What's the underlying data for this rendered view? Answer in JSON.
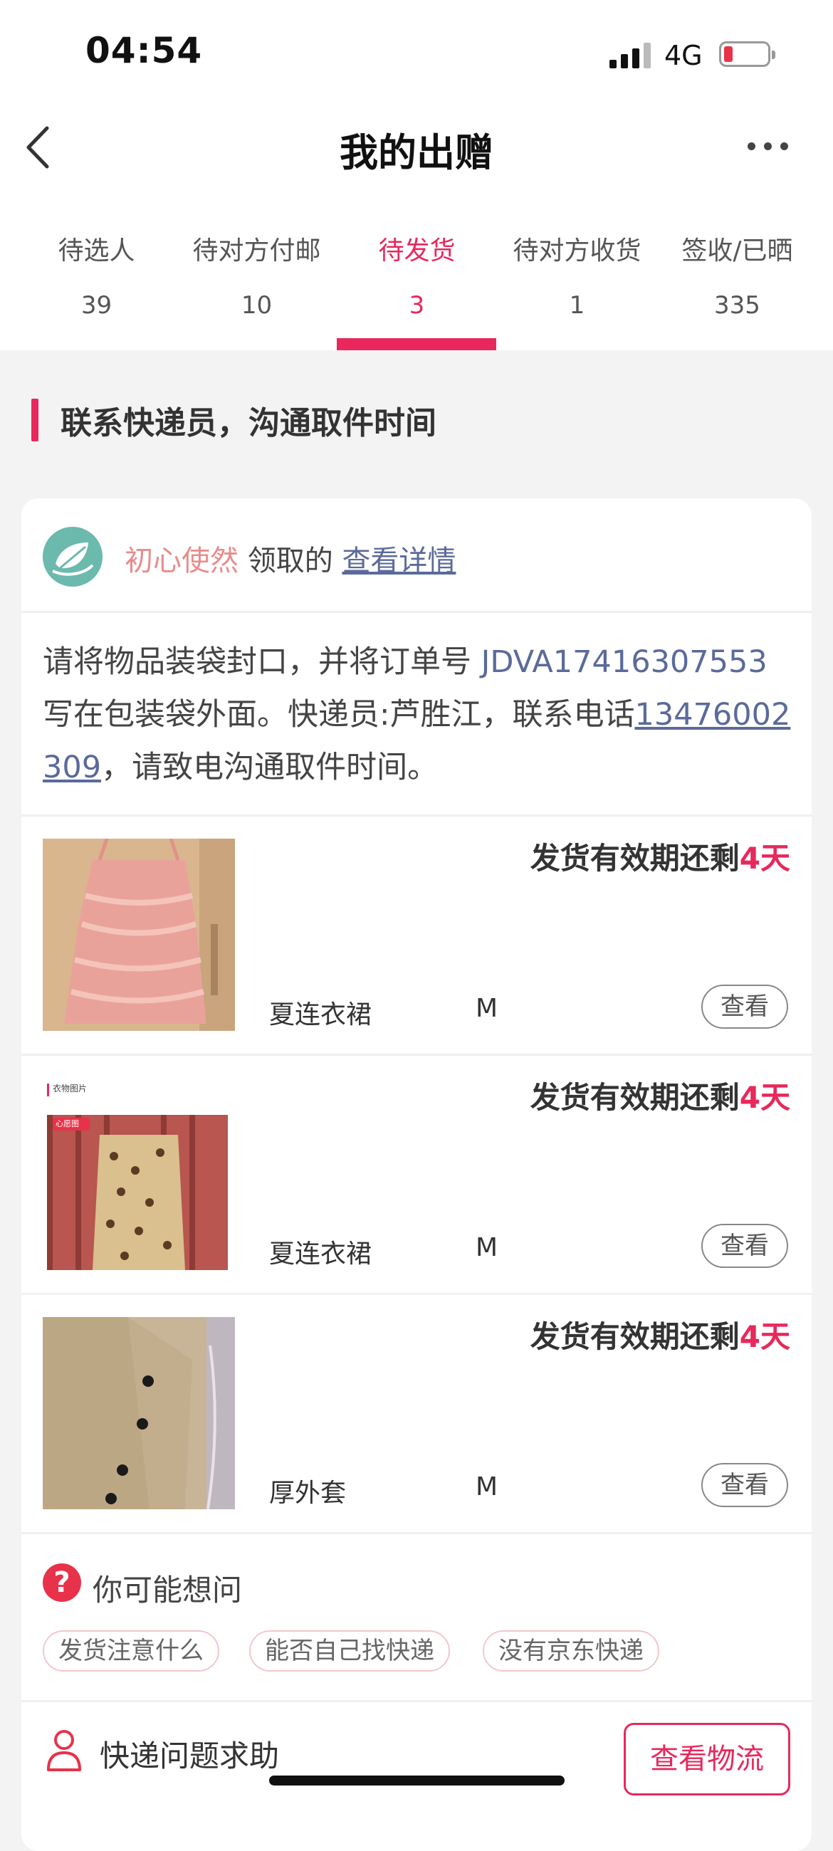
{
  "status_bar": {
    "time": "04:54",
    "network": "4G",
    "battery_color": "#e8324a"
  },
  "nav": {
    "title": "我的出赠",
    "back_icon": "chevron-left-icon",
    "more_icon": "more-horizontal-icon"
  },
  "tabs": [
    {
      "label": "待选人",
      "count": "39"
    },
    {
      "label": "待对方付邮",
      "count": "10"
    },
    {
      "label": "待发货",
      "count": "3",
      "active": true
    },
    {
      "label": "待对方收货",
      "count": "1"
    },
    {
      "label": "签收/已晒",
      "count": "335"
    }
  ],
  "section": {
    "title": "联系快递员，沟通取件时间"
  },
  "card": {
    "claimer_name": "初心使然",
    "claim_text": " 领取的 ",
    "detail_link": "查看详情",
    "instruction_pre": "请将物品装袋封口，并将订单号 ",
    "order_no": "JDVA17416307553",
    "instruction_mid": " 写在包装袋外面。快递员:芦胜江，联系电话",
    "phone": "13476002309",
    "instruction_post": "，请致电沟通取件时间。"
  },
  "items": [
    {
      "expire_text": "发货有效期还剩",
      "days": "4天",
      "name": "夏连衣裙",
      "size": "M",
      "view_label": "查看"
    },
    {
      "expire_text": "发货有效期还剩",
      "days": "4天",
      "name": "夏连衣裙",
      "size": "M",
      "view_label": "查看",
      "photo_caption": "衣物图片",
      "photo_tag": "心愿图"
    },
    {
      "expire_text": "发货有效期还剩",
      "days": "4天",
      "name": "厚外套",
      "size": "M",
      "view_label": "查看"
    }
  ],
  "faq": {
    "title": "你可能想问",
    "chips": [
      "发货注意什么",
      "能否自己找快递",
      "没有京东快递"
    ]
  },
  "help": {
    "label": "快递问题求助",
    "logistics_button": "查看物流"
  },
  "colors": {
    "accent": "#e8285c",
    "link": "#5b6a9a",
    "nickname": "#e88c8c"
  }
}
